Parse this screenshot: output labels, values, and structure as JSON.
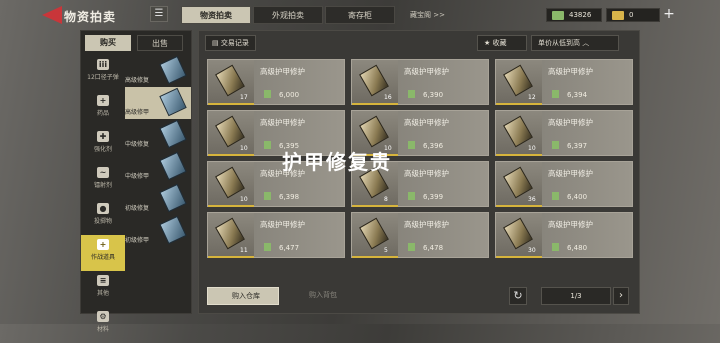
{
  "header": {
    "title": "物资拍卖",
    "tabs": [
      "物资拍卖",
      "外观拍卖",
      "寄存柜"
    ],
    "treasure_link": "藏宝阁 >>",
    "currency": "43826",
    "gold": "0"
  },
  "sidebar": {
    "buy": "购买",
    "sell": "出售",
    "categories": [
      {
        "label": "12口径子弹",
        "glyph": "iii"
      },
      {
        "label": "药品",
        "glyph": "+"
      },
      {
        "label": "强化剂",
        "glyph": "✚"
      },
      {
        "label": "镭射剂",
        "glyph": "~"
      },
      {
        "label": "投掷物",
        "glyph": "●"
      },
      {
        "label": "作战道具",
        "glyph": "+"
      },
      {
        "label": "其他",
        "glyph": "≡"
      },
      {
        "label": "材料",
        "glyph": "⚙"
      }
    ],
    "subitems": [
      "高级修复",
      "高级修甲",
      "中级修复",
      "中级修甲",
      "初级修复",
      "初级修甲"
    ]
  },
  "toolbar": {
    "trade_log": "交易记录",
    "favorite": "收藏",
    "sort": "单价从低到高 ︿"
  },
  "listings": [
    {
      "name": "高级护甲修护",
      "qty": "17",
      "price": "6,000"
    },
    {
      "name": "高级护甲修护",
      "qty": "16",
      "price": "6,390"
    },
    {
      "name": "高级护甲修护",
      "qty": "12",
      "price": "6,394"
    },
    {
      "name": "高级护甲修护",
      "qty": "10",
      "price": "6,395"
    },
    {
      "name": "高级护甲修护",
      "qty": "10",
      "price": "6,396"
    },
    {
      "name": "高级护甲修护",
      "qty": "10",
      "price": "6,397"
    },
    {
      "name": "高级护甲修护",
      "qty": "10",
      "price": "6,398"
    },
    {
      "name": "高级护甲修护",
      "qty": "8",
      "price": "6,399"
    },
    {
      "name": "高级护甲修护",
      "qty": "36",
      "price": "6,400"
    },
    {
      "name": "高级护甲修护",
      "qty": "11",
      "price": "6,477"
    },
    {
      "name": "高级护甲修护",
      "qty": "5",
      "price": "6,478"
    },
    {
      "name": "高级护甲修护",
      "qty": "30",
      "price": "6,480"
    }
  ],
  "overlay_text": "护甲修复贵",
  "bottom": {
    "warehouse": "购入仓库",
    "backpack": "购入背包",
    "page": "1/3"
  }
}
